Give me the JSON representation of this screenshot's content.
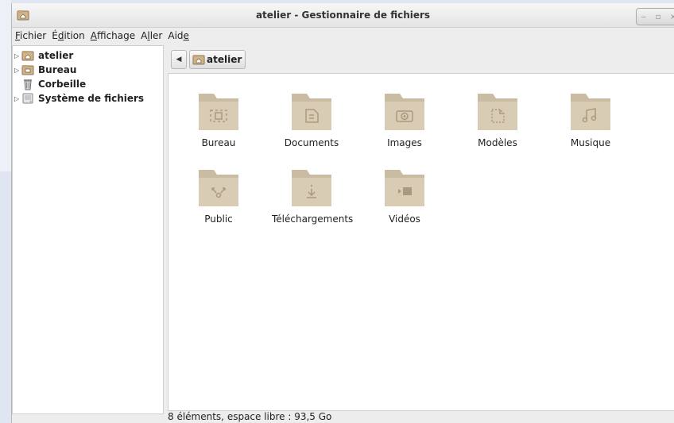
{
  "window": {
    "title": "atelier - Gestionnaire de fichiers",
    "wm_buttons": [
      "‒",
      "▫",
      "×"
    ]
  },
  "menubar": [
    {
      "pre": "",
      "key": "F",
      "post": "ichier"
    },
    {
      "pre": "É",
      "key": "d",
      "post": "ition"
    },
    {
      "pre": "",
      "key": "A",
      "post": "ffichage"
    },
    {
      "pre": "A",
      "key": "l",
      "post": "ler"
    },
    {
      "pre": "Aid",
      "key": "e",
      "post": ""
    }
  ],
  "sidebar": {
    "items": [
      {
        "label": "atelier",
        "icon": "home-folder-icon",
        "expandable": true
      },
      {
        "label": "Bureau",
        "icon": "desktop-folder-icon",
        "expandable": true
      },
      {
        "label": "Corbeille",
        "icon": "trash-icon",
        "expandable": false
      },
      {
        "label": "Système de fichiers",
        "icon": "drive-icon",
        "expandable": true
      }
    ]
  },
  "pathbar": {
    "back_icon": "back-arrow-icon",
    "crumb": "atelier"
  },
  "folders": [
    {
      "label": "Bureau",
      "emblem": "desktop-emblem-icon"
    },
    {
      "label": "Documents",
      "emblem": "document-emblem-icon"
    },
    {
      "label": "Images",
      "emblem": "camera-emblem-icon"
    },
    {
      "label": "Modèles",
      "emblem": "template-emblem-icon"
    },
    {
      "label": "Musique",
      "emblem": "music-emblem-icon"
    },
    {
      "label": "Public",
      "emblem": "share-emblem-icon"
    },
    {
      "label": "Téléchargements",
      "emblem": "download-emblem-icon"
    },
    {
      "label": "Vidéos",
      "emblem": "video-emblem-icon"
    }
  ],
  "statusbar": "8 éléments, espace libre : 93,5 Go",
  "colors": {
    "folder_body": "#d8ccb4",
    "folder_tab": "#c9bca2",
    "folder_emblem": "#a99a7e"
  }
}
